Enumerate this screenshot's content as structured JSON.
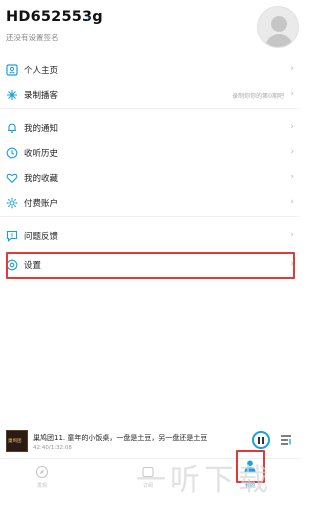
{
  "profile": {
    "username": "HD652553g",
    "signature": "还没有设置签名"
  },
  "menu_items": [
    {
      "label": "个人主页",
      "icon": "user-card-icon",
      "extra": ""
    },
    {
      "label": "录制播客",
      "icon": "sparkle-icon",
      "extra": "录制你你的第0期吧"
    },
    {
      "label": "我的通知",
      "icon": "bell-icon",
      "extra": ""
    },
    {
      "label": "收听历史",
      "icon": "clock-icon",
      "extra": ""
    },
    {
      "label": "我的收藏",
      "icon": "heart-icon",
      "extra": ""
    },
    {
      "label": "付费账户",
      "icon": "gear-icon",
      "extra": ""
    },
    {
      "label": "问题反馈",
      "icon": "feedback-icon",
      "extra": ""
    },
    {
      "label": "设置",
      "icon": "settings-icon",
      "extra": ""
    }
  ],
  "player": {
    "track_title": "巢鸠团11. 童年的小饭桌，一盘是土豆，另一盘还是土豆",
    "time": "42:40/1:32:08",
    "cover_text": "巢鸠团"
  },
  "tabbar": {
    "tabs": [
      {
        "label": "发现",
        "icon": "compass-icon"
      },
      {
        "label": "订阅",
        "icon": "subscribe-icon"
      },
      {
        "label": "我的",
        "icon": "person-icon"
      }
    ]
  },
  "watermark": {
    "text": "一听下载"
  },
  "colors": {
    "accent": "#1aa0e0",
    "highlight": "#e03a3a"
  }
}
